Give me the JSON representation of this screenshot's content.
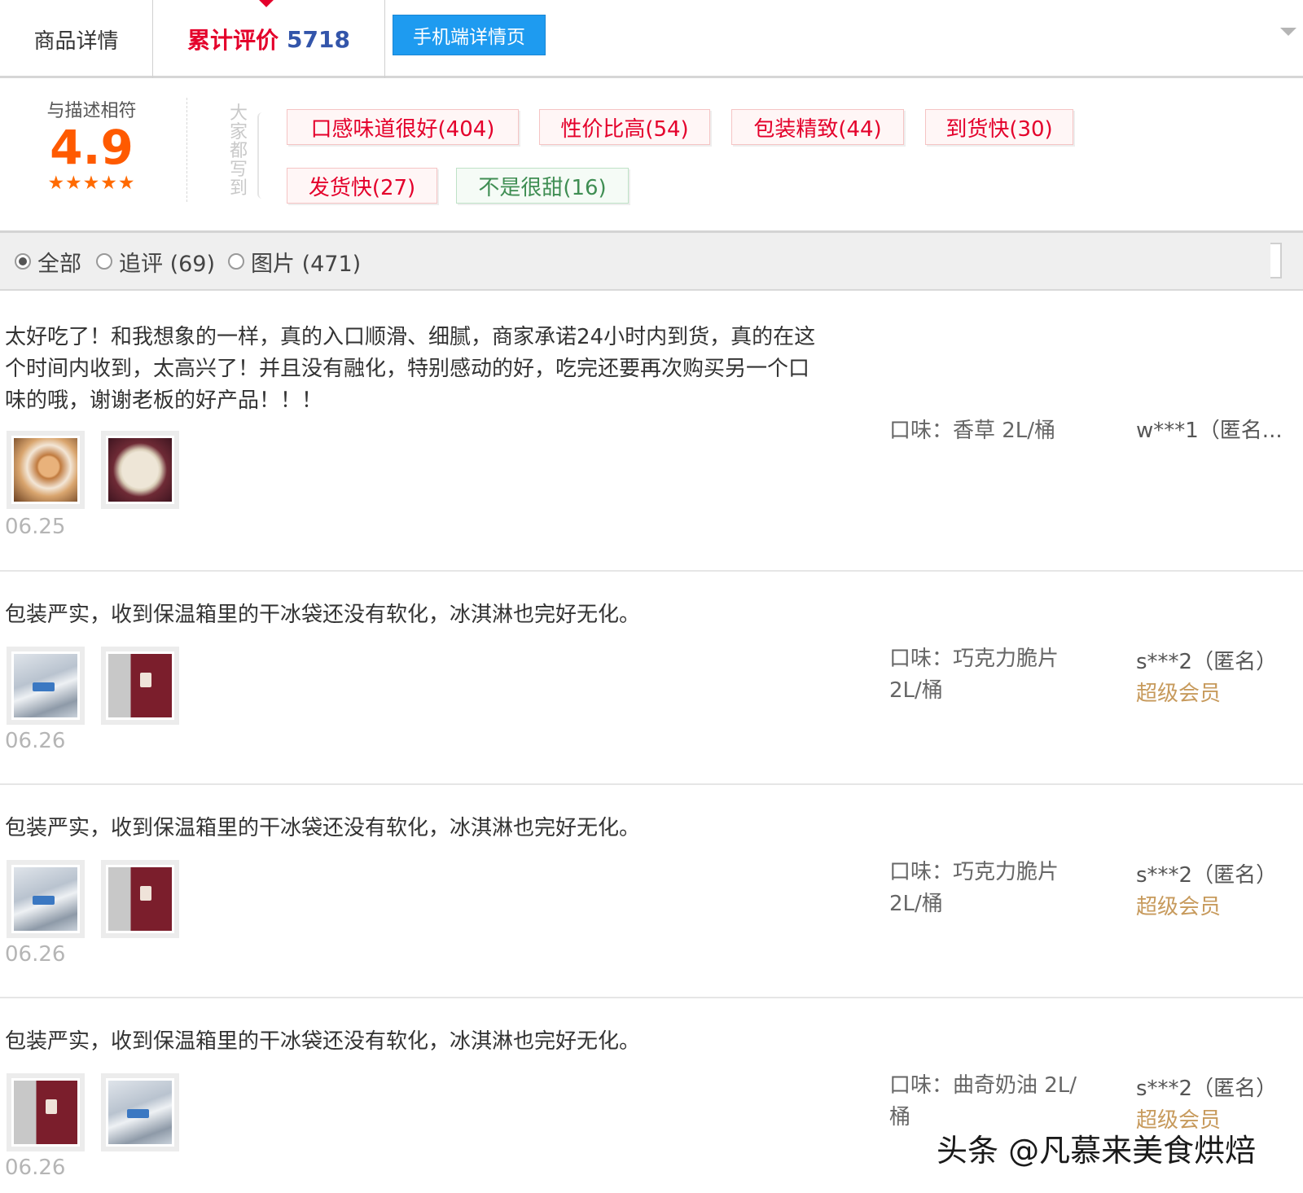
{
  "tabs": {
    "detail": "商品详情",
    "reviews_label": "累计评价",
    "reviews_count": "5718",
    "mobile": "手机端详情页"
  },
  "rating": {
    "label": "与描述相符",
    "score": "4.9",
    "stars": "★★★★★"
  },
  "tags": {
    "caption": [
      "大",
      "家",
      "都",
      "写",
      "到"
    ],
    "items": [
      {
        "text": "口感味道很好(404)",
        "sentiment": "positive"
      },
      {
        "text": "性价比高(54)",
        "sentiment": "positive"
      },
      {
        "text": "包装精致(44)",
        "sentiment": "positive"
      },
      {
        "text": "到货快(30)",
        "sentiment": "positive"
      },
      {
        "text": "发货快(27)",
        "sentiment": "positive"
      },
      {
        "text": "不是很甜(16)",
        "sentiment": "negative"
      }
    ]
  },
  "filters": [
    {
      "label": "全部",
      "checked": true
    },
    {
      "label": "追评 (69)",
      "checked": false
    },
    {
      "label": "图片 (471)",
      "checked": false
    }
  ],
  "reviews": [
    {
      "text": "太好吃了！和我想象的一样，真的入口顺滑、细腻，商家承诺24小时内到货，真的在这个时间内收到，太高兴了！并且没有融化，特别感动的好，吃完还要再次购买另一个口味的哦，谢谢老板的好产品！！！",
      "date": "06.25",
      "flavor": "口味：香草 2L/桶",
      "user": "w***1（匿名...",
      "member": ""
    },
    {
      "text": "包装严实，收到保温箱里的干冰袋还没有软化，冰淇淋也完好无化。",
      "date": "06.26",
      "flavor": "口味：巧克力脆片 2L/桶",
      "user": "s***2（匿名）",
      "member": "超级会员"
    },
    {
      "text": "包装严实，收到保温箱里的干冰袋还没有软化，冰淇淋也完好无化。",
      "date": "06.26",
      "flavor": "口味：巧克力脆片 2L/桶",
      "user": "s***2（匿名）",
      "member": "超级会员"
    },
    {
      "text": "包装严实，收到保温箱里的干冰袋还没有软化，冰淇淋也完好无化。",
      "date": "06.26",
      "flavor": "口味：曲奇奶油 2L/桶",
      "user": "s***2（匿名）",
      "member": "超级会员"
    }
  ],
  "watermark": "头条 @凡慕来美食烘焙",
  "colors": {
    "accent_red": "#e4002b",
    "score_orange": "#ff5a00",
    "mobile_blue": "#1e9bf0",
    "member_gold": "#c79a5c",
    "negative_green": "#3f8e53"
  }
}
